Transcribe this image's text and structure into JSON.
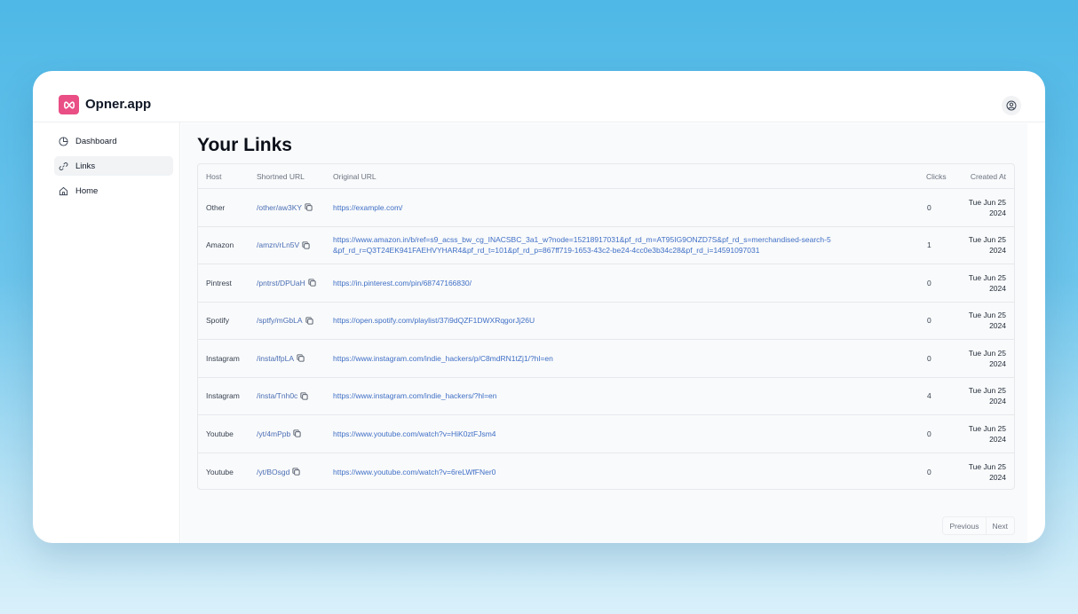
{
  "app": {
    "brand": "Opner.app",
    "accent": "#e94e84"
  },
  "sidebar": {
    "items": [
      {
        "label": "Dashboard",
        "icon": "pie-chart-icon",
        "active": false
      },
      {
        "label": "Links",
        "icon": "link-icon",
        "active": true
      },
      {
        "label": "Home",
        "icon": "home-icon",
        "active": false
      }
    ]
  },
  "main": {
    "title": "Your Links"
  },
  "table": {
    "columns": {
      "host": "Host",
      "short": "Shortned URL",
      "original": "Original URL",
      "clicks": "Clicks",
      "created": "Created At"
    },
    "rows": [
      {
        "host": "Other",
        "short": "/other/aw3KY",
        "original": "https://example.com/",
        "clicks": "0",
        "date1": "Tue Jun 25",
        "date2": "2024"
      },
      {
        "host": "Amazon",
        "short": "/amzn/rLn5V",
        "original": "https://www.amazon.in/b/ref=s9_acss_bw_cg_INACSBC_3a1_w?node=15218917031&pf_rd_m=AT95IG9ONZD7S&pf_rd_s=merchandised-search-5&pf_rd_r=Q3T24EK941FAEHVYHAR4&pf_rd_t=101&pf_rd_p=867ff719-1653-43c2-be24-4cc0e3b34c28&pf_rd_i=14591097031",
        "clicks": "1",
        "date1": "Tue Jun 25",
        "date2": "2024"
      },
      {
        "host": "Pintrest",
        "short": "/pntrst/DPUaH",
        "original": "https://in.pinterest.com/pin/68747166830/",
        "clicks": "0",
        "date1": "Tue Jun 25",
        "date2": "2024"
      },
      {
        "host": "Spotify",
        "short": "/sptfy/mGbLA",
        "original": "https://open.spotify.com/playlist/37i9dQZF1DWXRqgorJj26U",
        "clicks": "0",
        "date1": "Tue Jun 25",
        "date2": "2024"
      },
      {
        "host": "Instagram",
        "short": "/insta/lfpLA",
        "original": "https://www.instagram.com/indie_hackers/p/C8mdRN1tZj1/?hl=en",
        "clicks": "0",
        "date1": "Tue Jun 25",
        "date2": "2024"
      },
      {
        "host": "Instagram",
        "short": "/insta/Tnh0c",
        "original": "https://www.instagram.com/indie_hackers/?hl=en",
        "clicks": "4",
        "date1": "Tue Jun 25",
        "date2": "2024"
      },
      {
        "host": "Youtube",
        "short": "/yt/4mPpb",
        "original": "https://www.youtube.com/watch?v=HiK0ztFJsm4",
        "clicks": "0",
        "date1": "Tue Jun 25",
        "date2": "2024"
      },
      {
        "host": "Youtube",
        "short": "/yt/BOsgd",
        "original": "https://www.youtube.com/watch?v=6reLWfFNer0",
        "clicks": "0",
        "date1": "Tue Jun 25",
        "date2": "2024"
      }
    ]
  },
  "pagination": {
    "previous": "Previous",
    "next": "Next"
  }
}
